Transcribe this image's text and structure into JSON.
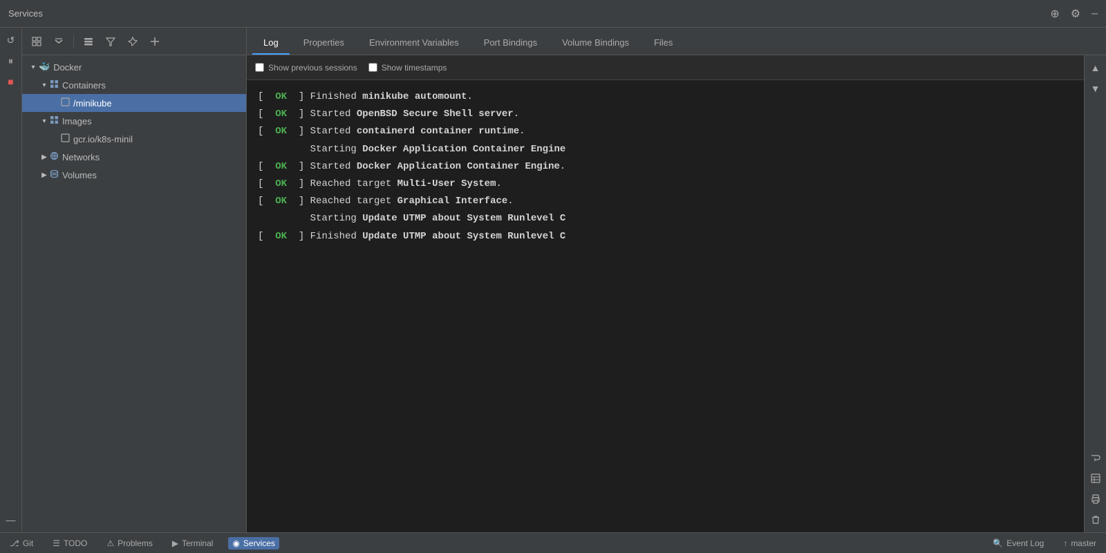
{
  "titleBar": {
    "title": "Services",
    "icons": [
      "globe-icon",
      "gear-icon",
      "minimize-icon"
    ]
  },
  "sidebar": {
    "toolbar": {
      "buttons": [
        "refresh-icon",
        "collapse-all-icon",
        "expand-all-icon",
        "filter-icon",
        "pin-icon",
        "add-icon"
      ]
    },
    "tree": [
      {
        "id": "docker",
        "label": "Docker",
        "level": 1,
        "expanded": true,
        "icon": "docker-icon",
        "type": "group"
      },
      {
        "id": "containers",
        "label": "Containers",
        "level": 2,
        "expanded": true,
        "icon": "grid-icon",
        "type": "group"
      },
      {
        "id": "minikube",
        "label": "/minikube",
        "level": 3,
        "expanded": false,
        "icon": "container-icon",
        "selected": true,
        "type": "item"
      },
      {
        "id": "images",
        "label": "Images",
        "level": 2,
        "expanded": true,
        "icon": "grid-icon",
        "type": "group"
      },
      {
        "id": "gcr-image",
        "label": "gcr.io/k8s-minil",
        "level": 3,
        "expanded": false,
        "icon": "image-icon",
        "type": "item"
      },
      {
        "id": "networks",
        "label": "Networks",
        "level": 2,
        "expanded": false,
        "icon": "network-icon",
        "type": "group"
      },
      {
        "id": "volumes",
        "label": "Volumes",
        "level": 2,
        "expanded": false,
        "icon": "volumes-icon",
        "type": "group"
      }
    ]
  },
  "tabs": [
    {
      "id": "log",
      "label": "Log",
      "active": true
    },
    {
      "id": "properties",
      "label": "Properties",
      "active": false
    },
    {
      "id": "environment-variables",
      "label": "Environment Variables",
      "active": false
    },
    {
      "id": "port-bindings",
      "label": "Port Bindings",
      "active": false
    },
    {
      "id": "volume-bindings",
      "label": "Volume Bindings",
      "active": false
    },
    {
      "id": "files",
      "label": "Files",
      "active": false
    }
  ],
  "logToolbar": {
    "showPreviousSessions": "Show previous sessions",
    "showTimestamps": "Show timestamps"
  },
  "logLines": [
    {
      "bracket": "[",
      "ok": "  OK  ",
      "close": "]",
      "msg": " Finished ",
      "bold": "minikube automount",
      "end": "."
    },
    {
      "bracket": "[",
      "ok": "  OK  ",
      "close": "]",
      "msg": " Started ",
      "bold": "OpenBSD Secure Shell server",
      "end": "."
    },
    {
      "bracket": "[",
      "ok": "  OK  ",
      "close": "]",
      "msg": " Started ",
      "bold": "containerd container runtime",
      "end": "."
    },
    {
      "bracket": " ",
      "ok": "",
      "close": "",
      "msg": "         Starting ",
      "bold": "Docker Application Container Engine",
      "end": ""
    },
    {
      "bracket": "[",
      "ok": "  OK  ",
      "close": "]",
      "msg": " Started ",
      "bold": "Docker Application Container Engine",
      "end": "."
    },
    {
      "bracket": "[",
      "ok": "  OK  ",
      "close": "]",
      "msg": " Reached target ",
      "bold": "Multi-User System",
      "end": "."
    },
    {
      "bracket": "[",
      "ok": "  OK  ",
      "close": "]",
      "msg": " Reached target ",
      "bold": "Graphical Interface",
      "end": "."
    },
    {
      "bracket": " ",
      "ok": "",
      "close": "",
      "msg": "         Starting ",
      "bold": "Update UTMP about System Runlevel C",
      "end": ""
    },
    {
      "bracket": "[",
      "ok": "  OK  ",
      "close": "]",
      "msg": " Finished ",
      "bold": "Update UTMP about System Runlevel C",
      "end": ""
    }
  ],
  "rightActionBar": {
    "buttons": [
      "scroll-up-icon",
      "scroll-down-icon",
      "wrap-icon",
      "table-icon",
      "print-icon",
      "trash-icon"
    ]
  },
  "statusBar": {
    "left": [
      {
        "id": "git",
        "icon": "git-icon",
        "label": "Git"
      },
      {
        "id": "todo",
        "icon": "list-icon",
        "label": "TODO"
      },
      {
        "id": "problems",
        "icon": "warning-icon",
        "label": "Problems"
      },
      {
        "id": "terminal",
        "icon": "terminal-icon",
        "label": "Terminal"
      },
      {
        "id": "services",
        "icon": "services-icon",
        "label": "Services",
        "active": true
      }
    ],
    "right": [
      {
        "id": "event-log",
        "icon": "search-icon",
        "label": "Event Log"
      },
      {
        "id": "master",
        "icon": "vcs-icon",
        "label": "master"
      }
    ]
  },
  "colors": {
    "ok": "#4caf50",
    "activeTab": "#4a6fa5",
    "bg": "#1e1e1e",
    "sidebar": "#3c3f41"
  }
}
